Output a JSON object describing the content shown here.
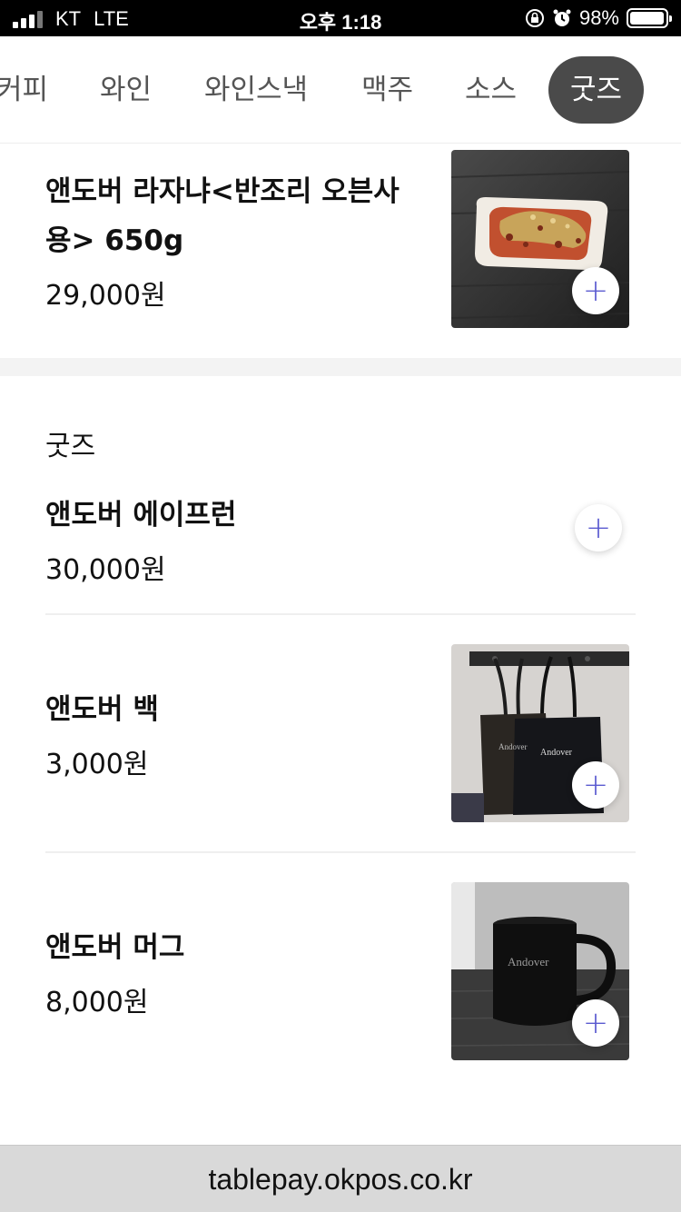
{
  "status_bar": {
    "carrier": "KT",
    "network": "LTE",
    "time": "오후 1:18",
    "battery": "98%",
    "battery_level": 0.98
  },
  "tabs": [
    {
      "label": "커피",
      "active": false
    },
    {
      "label": "와인",
      "active": false
    },
    {
      "label": "와인스낵",
      "active": false
    },
    {
      "label": "맥주",
      "active": false
    },
    {
      "label": "소스",
      "active": false
    },
    {
      "label": "굿즈",
      "active": true
    }
  ],
  "top_item": {
    "name_line1": "앤도버 라자냐<반조리 오븐사",
    "name_line2": "용> 650g",
    "price": "29,000원"
  },
  "section": {
    "title": "굿즈",
    "items": [
      {
        "name": "앤도버 에이프런",
        "price": "30,000원"
      },
      {
        "name": "앤도버 백",
        "price": "3,000원",
        "image_text": "Andover"
      },
      {
        "name": "앤도버 머그",
        "price": "8,000원",
        "image_text": "Andover"
      }
    ]
  },
  "add_icon": "+",
  "url_bar": {
    "url": "tablepay.okpos.co.kr"
  },
  "colors": {
    "accent": "#5a5ad0",
    "active_tab_bg": "#4a4a4a"
  }
}
